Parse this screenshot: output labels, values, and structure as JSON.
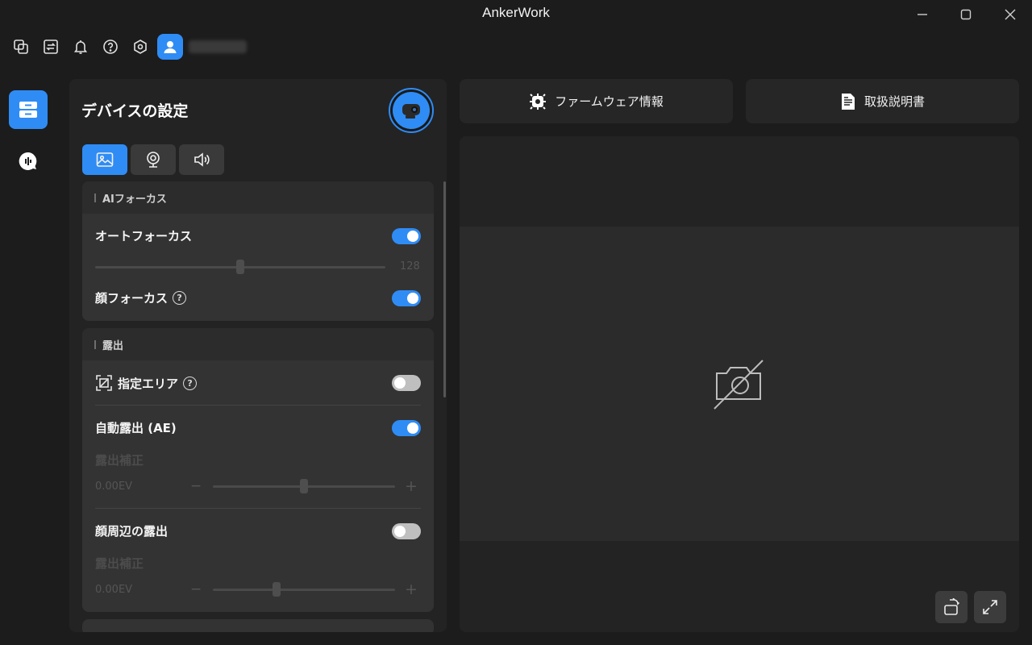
{
  "window": {
    "title": "AnkerWork"
  },
  "toolbar": {
    "icons": [
      "window-switch-icon",
      "transfer-icon",
      "bell-icon",
      "help-icon",
      "settings-hex-icon"
    ],
    "username": "••••••••"
  },
  "nav": {
    "items": [
      "device-settings-icon",
      "audio-recorder-icon"
    ]
  },
  "settings": {
    "title": "デバイスの設定",
    "tabs": [
      "image-tab-icon",
      "webcam-tab-icon",
      "speaker-tab-icon"
    ],
    "ai_focus": {
      "header": "AIフォーカス",
      "autofocus_label": "オートフォーカス",
      "autofocus_on": true,
      "focus_value": "128",
      "focus_level": 0.5,
      "face_focus_label": "顔フォーカス",
      "face_focus_on": true
    },
    "exposure": {
      "header": "露出",
      "area_label": "指定エリア",
      "area_on": false,
      "ae_label": "自動露出 (AE)",
      "ae_on": true,
      "comp_label": "露出補正",
      "comp_value": "0.00EV",
      "comp_level": 0.5,
      "face_exposure_label": "顔周辺の露出",
      "face_exposure_on": false,
      "comp2_label": "露出補正",
      "comp2_value": "0.00EV",
      "comp2_level": 0.35,
      "minus": "−",
      "plus": "+"
    }
  },
  "actions": {
    "firmware_label": "ファームウェア情報",
    "manual_label": "取扱説明書"
  },
  "colors": {
    "accent": "#2f8cf5",
    "background": "#1c1c1c",
    "panel": "#232323"
  }
}
